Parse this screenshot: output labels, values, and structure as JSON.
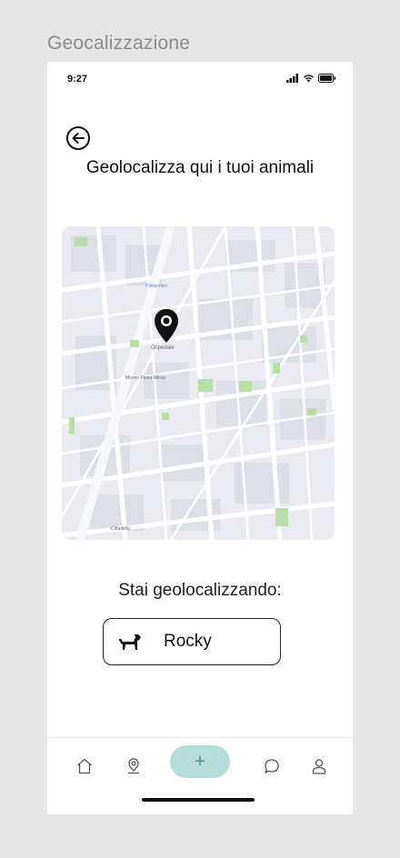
{
  "frame": {
    "label": "Geocalizzazione"
  },
  "status_bar": {
    "time": "9:27"
  },
  "screen": {
    "title": "Geolocalizza qui i tuoi animali",
    "subtitle": "Stai geolocalizzando:"
  },
  "map": {
    "labels": [
      "Ospedale",
      "Museo Pietro Micca",
      "Politecnico",
      "Cittadella"
    ]
  },
  "pet": {
    "name": "Rocky"
  },
  "tabbar": {
    "add_label": "+"
  },
  "colors": {
    "accent": "#b6ddd7",
    "accent_text": "#4b8b84",
    "map_park": "#b7dfa5"
  }
}
